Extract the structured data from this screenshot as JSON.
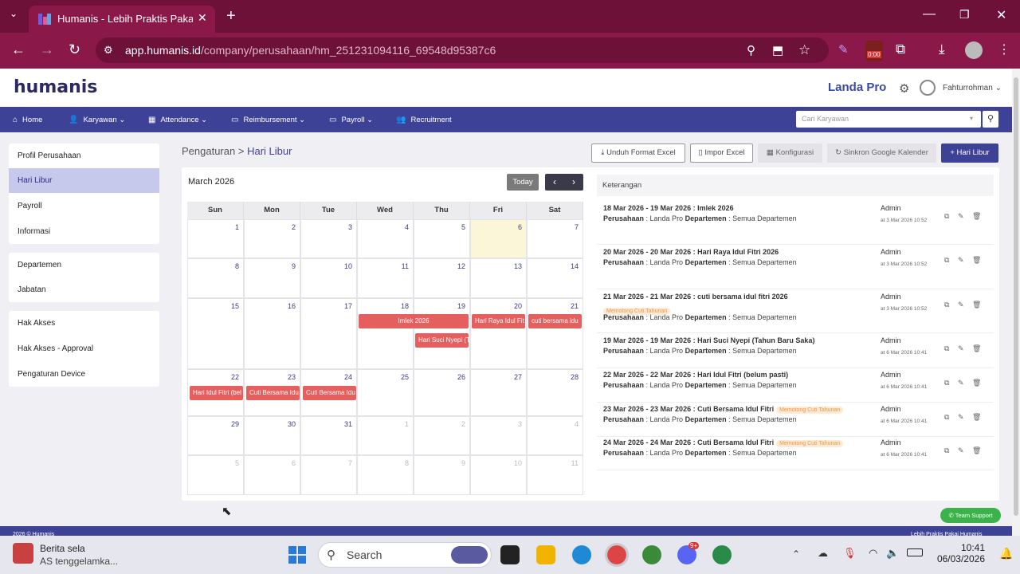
{
  "browser": {
    "tab_title": "Humanis - Lebih Praktis Pakai H",
    "url_host": "app.humanis.id",
    "url_path": "/company/perusahaan/hm_251231094116_69548d95387c6",
    "timer_badge": "0:00"
  },
  "app": {
    "logo": "humanis",
    "company": "Landa Pro",
    "user": "Fahturrohman"
  },
  "nav": {
    "items": [
      "Home",
      "Karyawan",
      "Attendance",
      "Reimbursement",
      "Payroll",
      "Recruitment"
    ],
    "search_placeholder": "Cari Karyawan"
  },
  "sidebar": {
    "group1": [
      "Profil Perusahaan",
      "Hari Libur",
      "Payroll",
      "Informasi"
    ],
    "group2": [
      "Departemen",
      "Jabatan"
    ],
    "group3": [
      "Hak Akses",
      "Hak Akses - Approval",
      "Pengaturan Device"
    ]
  },
  "breadcrumb": {
    "root": "Pengaturan",
    "sep": ">",
    "current": "Hari Libur"
  },
  "actions": {
    "unduh": "Unduh Format Excel",
    "impor": "Impor Excel",
    "konfigurasi": "Konfigurasi",
    "sinkron": "Sinkron Google Kalender",
    "tambah": "Hari Libur"
  },
  "calendar": {
    "month_label": "March 2026",
    "today_label": "Today",
    "days": [
      "Sun",
      "Mon",
      "Tue",
      "Wed",
      "Thu",
      "Fri",
      "Sat"
    ],
    "weeks": [
      [
        "1",
        "2",
        "3",
        "4",
        "5",
        "6",
        "7"
      ],
      [
        "8",
        "9",
        "10",
        "11",
        "12",
        "13",
        "14"
      ],
      [
        "15",
        "16",
        "17",
        "18",
        "19",
        "20",
        "21"
      ],
      [
        "22",
        "23",
        "24",
        "25",
        "26",
        "27",
        "28"
      ],
      [
        "29",
        "30",
        "31",
        "1",
        "2",
        "3",
        "4"
      ],
      [
        "5",
        "6",
        "7",
        "8",
        "9",
        "10",
        "11"
      ]
    ],
    "events": {
      "imlek": "Imlek 2026",
      "nyepi": "Hari Suci Nyepi (T",
      "raya": "Hari Raya Idul Fit",
      "cuti21": "cuti bersama idu",
      "idul22": "Hari Idul Fitri (bel",
      "cuti23": "Cuti Bersama Idu",
      "cuti24": "Cuti Bersama Idu"
    }
  },
  "keterangan": {
    "header": "Keterangan",
    "perusahaan_label": "Perusahaan",
    "departemen_label": "Departemen",
    "entries": [
      {
        "title": "18 Mar 2026 - 19 Mar 2026 : Imlek 2026",
        "tag": "",
        "company": " : Landa Pro ",
        "dept": " : Semua Departemen",
        "by": "Admin",
        "date": "at 3 Mar 2026 10:52"
      },
      {
        "title": "20 Mar 2026 - 20 Mar 2026 : Hari Raya Idul Fitri 2026",
        "tag": "",
        "company": " : Landa Pro ",
        "dept": " : Semua Departemen",
        "by": "Admin",
        "date": "at 3 Mar 2026 10:52"
      },
      {
        "title": "21 Mar 2026 - 21 Mar 2026 : cuti bersama idul fitri 2026",
        "tag": "Memotong Cuti Tahunan",
        "company": " : Landa Pro ",
        "dept": " : Semua Departemen",
        "by": "Admin",
        "date": "at 3 Mar 2026 10:52"
      },
      {
        "title": "19 Mar 2026 - 19 Mar 2026 : Hari Suci Nyepi (Tahun Baru Saka)",
        "tag": "",
        "company": " : Landa Pro ",
        "dept": " : Semua Departemen",
        "by": "Admin",
        "date": "at 6 Mar 2026 10:41"
      },
      {
        "title": "22 Mar 2026 - 22 Mar 2026 : Hari Idul Fitri (belum pasti)",
        "tag": "",
        "company": " : Landa Pro ",
        "dept": " : Semua Departemen",
        "by": "Admin",
        "date": "at 6 Mar 2026 10:41"
      },
      {
        "title": "23 Mar 2026 - 23 Mar 2026 : Cuti Bersama Idul Fitri",
        "tag": "Memotong Cuti Tahunan",
        "company": " : Landa Pro ",
        "dept": " : Semua Departemen",
        "by": "Admin",
        "date": "at 6 Mar 2026 10:41"
      },
      {
        "title": "24 Mar 2026 - 24 Mar 2026 : Cuti Bersama Idul Fitri",
        "tag": "Memotong Cuti Tahunan",
        "company": " : Landa Pro ",
        "dept": " : Semua Departemen",
        "by": "Admin",
        "date": "at 6 Mar 2026 10:41"
      }
    ]
  },
  "support": "Team Support",
  "footer": {
    "left": "2026 © Humanis",
    "right": "Lebih Praktis Pakai Humanis"
  },
  "taskbar": {
    "weather_title": "Berita sela",
    "weather_sub": "AS tenggelamka...",
    "search": "Search",
    "time": "10:41",
    "date": "06/03/2026",
    "discord_badge": "9+"
  }
}
